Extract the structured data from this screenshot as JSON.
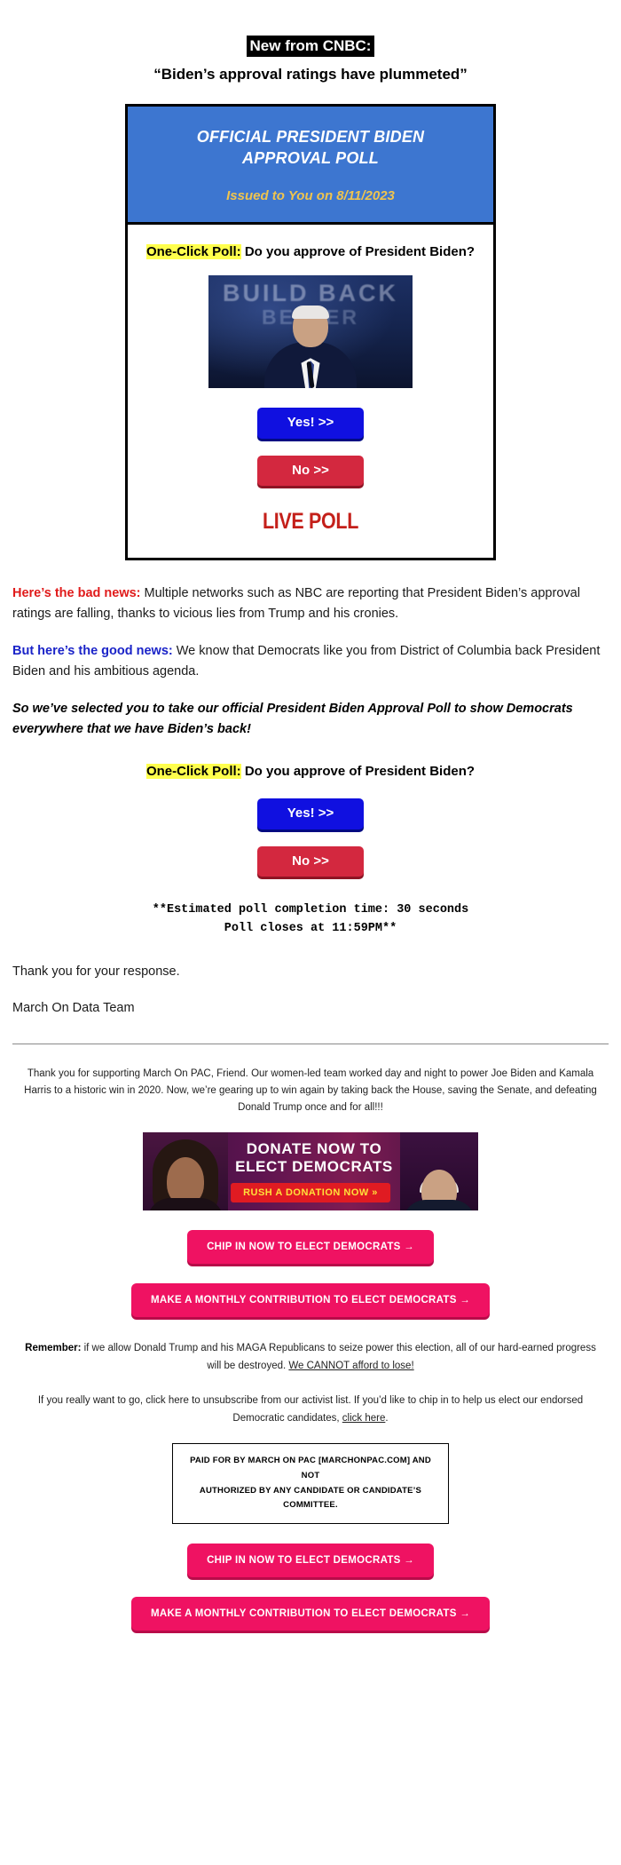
{
  "header": {
    "source_tag": "New from CNBC:",
    "quote": "“Biden’s approval ratings have plummeted”"
  },
  "poll_card": {
    "banner_title_line1": "OFFICIAL PRESIDENT BIDEN",
    "banner_title_line2": "APPROVAL POLL",
    "banner_date": "Issued to You on 8/11/2023",
    "question_label": "One-Click Poll:",
    "question_text": " Do you approve of President Biden?",
    "photo_backdrop_line1": "BUILD BACK",
    "photo_backdrop_line2": "BETTER",
    "yes_button": "Yes! >>",
    "no_button": "No >>",
    "live_poll_label": "LIVE POLL"
  },
  "body": {
    "bad_news_lead": "Here’s the bad news:",
    "bad_news_text": " Multiple networks such as NBC are reporting that President Biden’s approval ratings are falling, thanks to vicious lies from Trump and his cronies.",
    "good_news_lead": "But here’s the good news:",
    "good_news_text": " We know that Democrats like you from District of Columbia back President Biden and his ambitious agenda.",
    "emphasis": "So we’ve selected you to take our official President Biden Approval Poll to show Democrats everywhere that we have Biden’s back!",
    "question_label": "One-Click Poll:",
    "question_text": " Do you approve of President Biden?",
    "yes_button": "Yes! >>",
    "no_button": "No >>",
    "mono_line1": "**Estimated poll completion time: 30 seconds",
    "mono_line2": "Poll closes at 11:59PM**",
    "thanks": "Thank you for your response.",
    "signature": "March On Data Team"
  },
  "footer": {
    "intro": "Thank you for supporting March On PAC, Friend. Our women-led team worked day and night to power Joe Biden and Kamala Harris to a historic win in 2020. Now, we’re gearing up to win again by taking back the House, saving the Senate, and defeating Donald Trump once and for all!!!",
    "banner_line1": "DONATE NOW TO",
    "banner_line2": "ELECT DEMOCRATS",
    "banner_cta": "RUSH A DONATION NOW »",
    "chip_in_button": "CHIP IN NOW TO ELECT DEMOCRATS →",
    "monthly_button": "MAKE A MONTHLY CONTRIBUTION TO ELECT DEMOCRATS →",
    "remember_lead": "Remember:",
    "remember_text": " if we allow Donald Trump and his MAGA Republicans to seize power this election, all of our hard-earned progress will be destroyed. ",
    "remember_underline": "We CANNOT afford to lose!",
    "unsub_text_1": "If you really want to go, click here to unsubscribe from our activist list. If you’d like to chip in to help us elect our endorsed Democratic candidates, ",
    "unsub_link": "click here",
    "unsub_text_2": ".",
    "paid_line1": "PAID FOR BY MARCH ON PAC [MARCHONPAC.COM] AND NOT",
    "paid_line2": "AUTHORIZED BY ANY CANDIDATE OR CANDIDATE’S COMMITTEE.",
    "chip_in_button_2": "CHIP IN NOW TO ELECT DEMOCRATS →",
    "monthly_button_2": "MAKE A MONTHLY CONTRIBUTION TO ELECT DEMOCRATS →"
  }
}
